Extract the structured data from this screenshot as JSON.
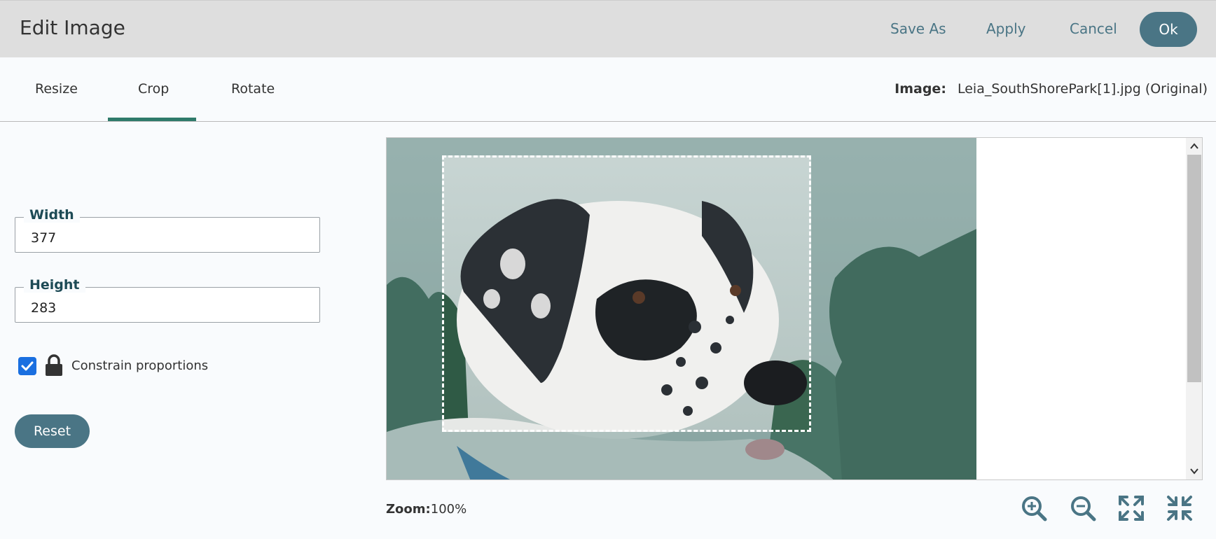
{
  "header": {
    "title": "Edit Image",
    "save_as": "Save As",
    "apply": "Apply",
    "cancel": "Cancel",
    "ok": "Ok"
  },
  "tabs": [
    {
      "label": "Resize",
      "active": false
    },
    {
      "label": "Crop",
      "active": true
    },
    {
      "label": "Rotate",
      "active": false
    }
  ],
  "image_info": {
    "label": "Image:",
    "filename": "Leia_SouthShorePark[1].jpg (Original)"
  },
  "crop": {
    "width_label": "Width",
    "width_value": "377",
    "height_label": "Height",
    "height_value": "283",
    "constrain_label": "Constrain proportions",
    "constrain_checked": true,
    "reset_label": "Reset"
  },
  "zoom": {
    "label": "Zoom:",
    "value": "100%"
  },
  "icons": [
    "zoom-in-icon",
    "zoom-out-icon",
    "expand-icon",
    "compress-icon",
    "lock-icon",
    "checkmark-icon"
  ],
  "colors": {
    "accent": "#4a7585",
    "tab_underline": "#2f7a6a",
    "checkbox": "#1a6fe0",
    "header_bg": "#dedede"
  }
}
